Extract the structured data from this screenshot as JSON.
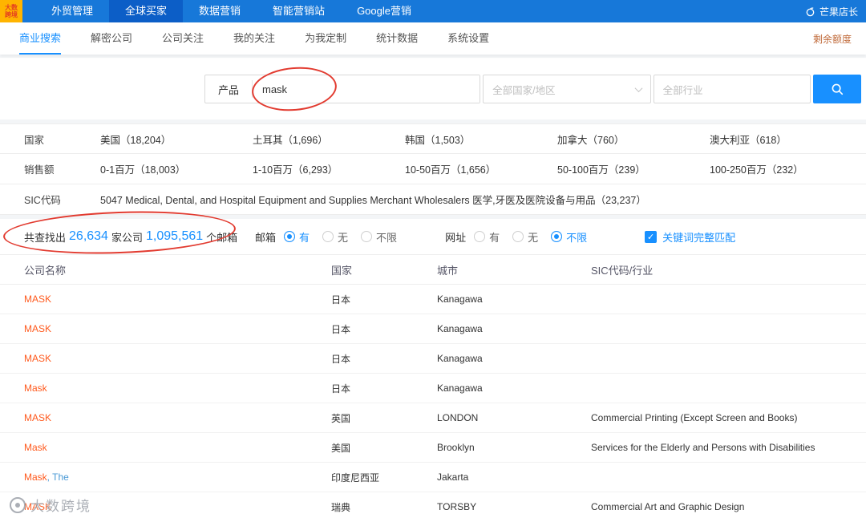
{
  "topnav": {
    "logo_line1": "大数",
    "logo_line2": "跨境",
    "items": [
      {
        "label": "外贸管理",
        "active": false
      },
      {
        "label": "全球买家",
        "active": true
      },
      {
        "label": "数据营销",
        "active": false
      },
      {
        "label": "智能营销站",
        "active": false
      },
      {
        "label": "Google营销",
        "active": false
      }
    ],
    "right_label": "芒果店长"
  },
  "subnav": {
    "items": [
      {
        "label": "商业搜索",
        "active": true
      },
      {
        "label": "解密公司",
        "active": false
      },
      {
        "label": "公司关注",
        "active": false
      },
      {
        "label": "我的关注",
        "active": false
      },
      {
        "label": "为我定制",
        "active": false
      },
      {
        "label": "统计数据",
        "active": false
      },
      {
        "label": "系统设置",
        "active": false
      }
    ],
    "right_label": "剩余额度"
  },
  "search": {
    "product_label": "产品",
    "keyword": "mask",
    "country_placeholder": "全部国家/地区",
    "industry_placeholder": "全部行业"
  },
  "filters": {
    "country": {
      "label": "国家",
      "options": [
        "美国（18,204）",
        "土耳其（1,696）",
        "韩国（1,503）",
        "加拿大（760）",
        "澳大利亚（618）"
      ]
    },
    "sales": {
      "label": "销售额",
      "options": [
        "0-1百万（18,003）",
        "1-10百万（6,293）",
        "10-50百万（1,656）",
        "50-100百万（239）",
        "100-250百万（232）"
      ]
    },
    "sic": {
      "label": "SIC代码",
      "options": [
        "5047 Medical, Dental, and Hospital Equipment and Supplies Merchant Wholesalers 医学,牙医及医院设备与用品（23,237）"
      ]
    }
  },
  "summary": {
    "prefix": "共查找出",
    "companies": "26,634",
    "companies_suffix": "家公司",
    "emails": "1,095,561",
    "emails_suffix": "个邮箱",
    "email_label": "邮箱",
    "email_options": [
      {
        "label": "有",
        "selected": true
      },
      {
        "label": "无",
        "selected": false
      },
      {
        "label": "不限",
        "selected": false
      }
    ],
    "url_label": "网址",
    "url_options": [
      {
        "label": "有",
        "selected": false
      },
      {
        "label": "无",
        "selected": false
      },
      {
        "label": "不限",
        "selected": true
      }
    ],
    "exact_match": "关键词完整匹配"
  },
  "table": {
    "headers": [
      "公司名称",
      "国家",
      "城市",
      "SIC代码/行业"
    ],
    "rows": [
      {
        "name_match": "MASK",
        "name_rest": "",
        "country": "日本",
        "city": "Kanagawa",
        "sic": ""
      },
      {
        "name_match": "MASK",
        "name_rest": "",
        "country": "日本",
        "city": "Kanagawa",
        "sic": ""
      },
      {
        "name_match": "MASK",
        "name_rest": "",
        "country": "日本",
        "city": "Kanagawa",
        "sic": ""
      },
      {
        "name_match": "Mask",
        "name_rest": "",
        "country": "日本",
        "city": "Kanagawa",
        "sic": ""
      },
      {
        "name_match": "MASK",
        "name_rest": "",
        "country": "英国",
        "city": "LONDON",
        "sic": "Commercial Printing (Except Screen and Books)"
      },
      {
        "name_match": "Mask",
        "name_rest": "",
        "country": "美国",
        "city": "Brooklyn",
        "sic": "Services for the Elderly and Persons with Disabilities"
      },
      {
        "name_match": "Mask",
        "name_rest": ", The",
        "country": "印度尼西亚",
        "city": "Jakarta",
        "sic": ""
      },
      {
        "name_match": "MASK",
        "name_rest": "",
        "country": "瑞典",
        "city": "TORSBY",
        "sic": "Commercial  Art  and  Graphic  Design"
      }
    ]
  },
  "watermark": {
    "text": "大数跨境"
  }
}
